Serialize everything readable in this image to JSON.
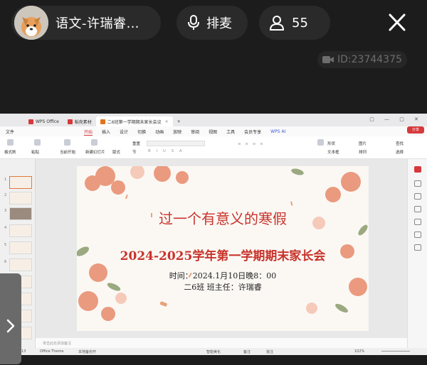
{
  "live": {
    "host_name": "语文-许瑞睿…",
    "mic_label": "排麦",
    "viewer_count": "55",
    "room_id": "ID:23744375"
  },
  "wps": {
    "tabs": [
      {
        "label": "WPS Office",
        "color": "#d6393c"
      },
      {
        "label": "稻壳素材",
        "color": "#d6393c"
      },
      {
        "label": "二6班第一学期期末家长会议",
        "color": "#e2721b"
      }
    ],
    "new_tab": "+",
    "menu": [
      "文件",
      "开始",
      "插入",
      "设计",
      "切换",
      "动画",
      "放映",
      "审阅",
      "视图",
      "工具",
      "会员专享",
      "WPS AI"
    ],
    "active_menu": "开始",
    "ribbon": {
      "format_painter": "格式刷",
      "paste": "粘贴",
      "start_from_current": "当前开始",
      "new_slide": "新建幻灯片",
      "layout": "版式",
      "section": "节",
      "reset": "重置",
      "shape": "形状",
      "picture": "图片",
      "find": "查找",
      "textbox": "文本框",
      "arrange": "排列",
      "select": "选择"
    },
    "share_label": "分享",
    "notes_placeholder": "单击此处添加备注",
    "status": {
      "theme": "Office Theme",
      "backup": "本地备份开",
      "beautify": "智能美化",
      "notes": "备注",
      "comments": "批注",
      "zoom": "102%",
      "slide_no": "13"
    },
    "slide": {
      "title": "过一个有意义的寒假",
      "subtitle": "2024-2025学年第一学期期末家长会",
      "time": "时间：2024.1月10日晚8：00",
      "class_teacher": "二6班   班主任：许瑞睿"
    }
  },
  "colors": {
    "accent": "#d6393c",
    "title_red": "#c8332b"
  }
}
